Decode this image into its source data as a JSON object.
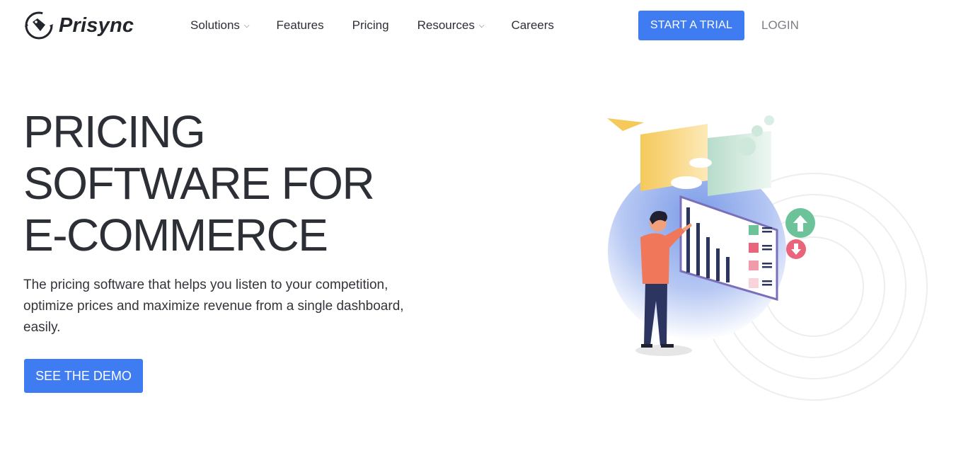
{
  "brand": {
    "name": "Prisync",
    "logo_icon": "price-tag-icon",
    "accent": "#3f7cf2"
  },
  "nav": {
    "items": [
      {
        "label": "Solutions",
        "has_dropdown": true
      },
      {
        "label": "Features",
        "has_dropdown": false
      },
      {
        "label": "Pricing",
        "has_dropdown": false
      },
      {
        "label": "Resources",
        "has_dropdown": true
      },
      {
        "label": "Careers",
        "has_dropdown": false
      }
    ],
    "trial_label": "START A TRIAL",
    "login_label": "LOGIN"
  },
  "hero": {
    "title_lines": [
      "PRICING",
      "SOFTWARE FOR",
      "E-COMMERCE"
    ],
    "description": "The pricing software that helps you listen to your competition, optimize prices and maximize revenue from a single dashboard, easily.",
    "cta_label": "SEE THE DEMO"
  }
}
